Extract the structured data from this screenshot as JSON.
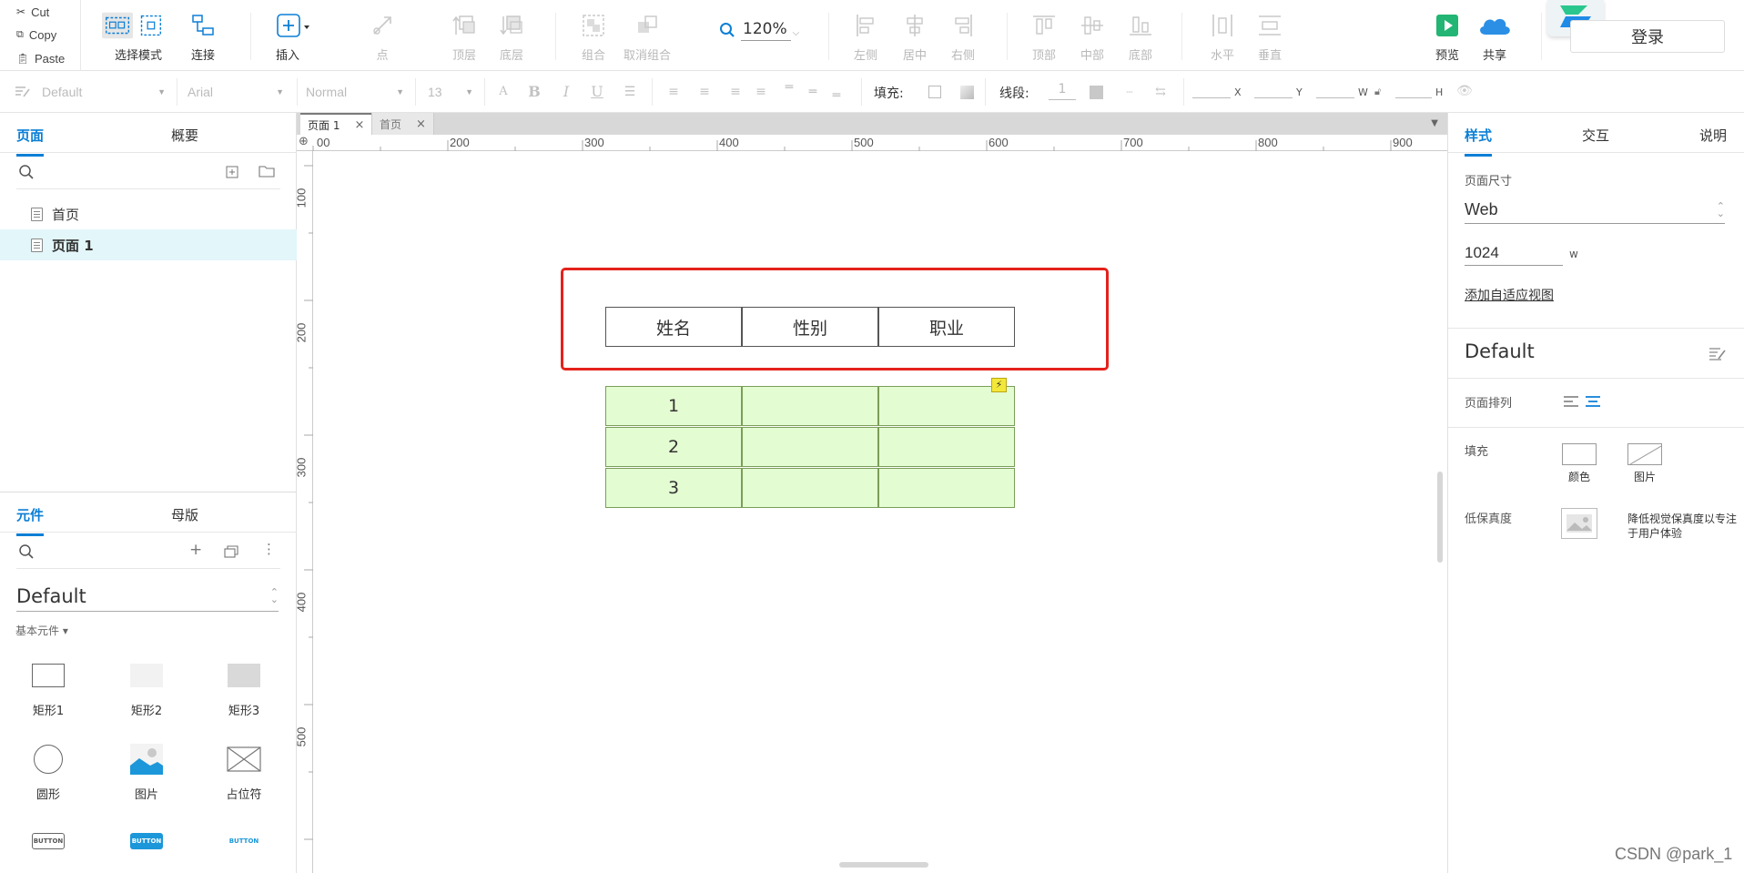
{
  "clipboard": {
    "cut": "Cut",
    "copy": "Copy",
    "paste": "Paste"
  },
  "toolbar": {
    "select_mode": "选择模式",
    "connect": "连接",
    "insert": "插入",
    "point": "点",
    "top_layer": "顶层",
    "bottom_layer": "底层",
    "group": "组合",
    "ungroup": "取消组合",
    "zoom": "120%",
    "align_left": "左侧",
    "align_center": "居中",
    "align_right": "右侧",
    "align_top": "顶部",
    "align_middle": "中部",
    "align_bottom": "底部",
    "distribute_h": "水平",
    "distribute_v": "垂直",
    "preview": "预览",
    "share": "共享",
    "login": "登录"
  },
  "format": {
    "style": "Default",
    "font": "Arial",
    "weight": "Normal",
    "size": "13",
    "fill_label": "填充:",
    "stroke_label": "线段:",
    "stroke_value": "1",
    "x": "X",
    "y": "Y",
    "w": "W",
    "h": "H"
  },
  "left_panel": {
    "tabs": [
      "页面",
      "概要"
    ],
    "pages": [
      "首页",
      "页面 1"
    ],
    "lib_tabs": [
      "元件",
      "母版"
    ],
    "library": "Default",
    "basic_label": "基本元件 ▾",
    "widgets": [
      "矩形1",
      "矩形2",
      "矩形3",
      "圆形",
      "图片",
      "占位符"
    ],
    "button_captions": [
      "BUTTON",
      "BUTTON",
      "BUTTON"
    ]
  },
  "doc_tabs": [
    "页面 1",
    "首页"
  ],
  "ruler": {
    "h": [
      "00",
      "200",
      "300",
      "400",
      "500",
      "600",
      "700",
      "800",
      "900"
    ],
    "v": [
      "100",
      "200",
      "300",
      "400",
      "500"
    ]
  },
  "canvas_table": {
    "headers": [
      "姓名",
      "性别",
      "职业"
    ],
    "rows": [
      [
        "1",
        "",
        ""
      ],
      [
        "2",
        "",
        ""
      ],
      [
        "3",
        "",
        ""
      ]
    ]
  },
  "right_panel": {
    "tabs": [
      "样式",
      "交互",
      "说明"
    ],
    "page_size_label": "页面尺寸",
    "page_size": "Web",
    "width": "1024",
    "width_unit": "w",
    "adaptive_link": "添加自适应视图",
    "style_name": "Default",
    "align_label": "页面排列",
    "fill_label": "填充",
    "fill_color": "颜色",
    "fill_image": "图片",
    "lowfi_label": "低保真度",
    "lowfi_desc_1": "降低视觉保真度以专注",
    "lowfi_desc_2": "于用户体验"
  },
  "watermark": "CSDN @park_1",
  "colors": {
    "accent": "#0b7fd6",
    "selection": "#e4221b",
    "cell_fill": "#e4fcd2",
    "cell_border": "#7a9e58",
    "preview_green": "#22b573",
    "share_blue": "#2b8fe5"
  }
}
